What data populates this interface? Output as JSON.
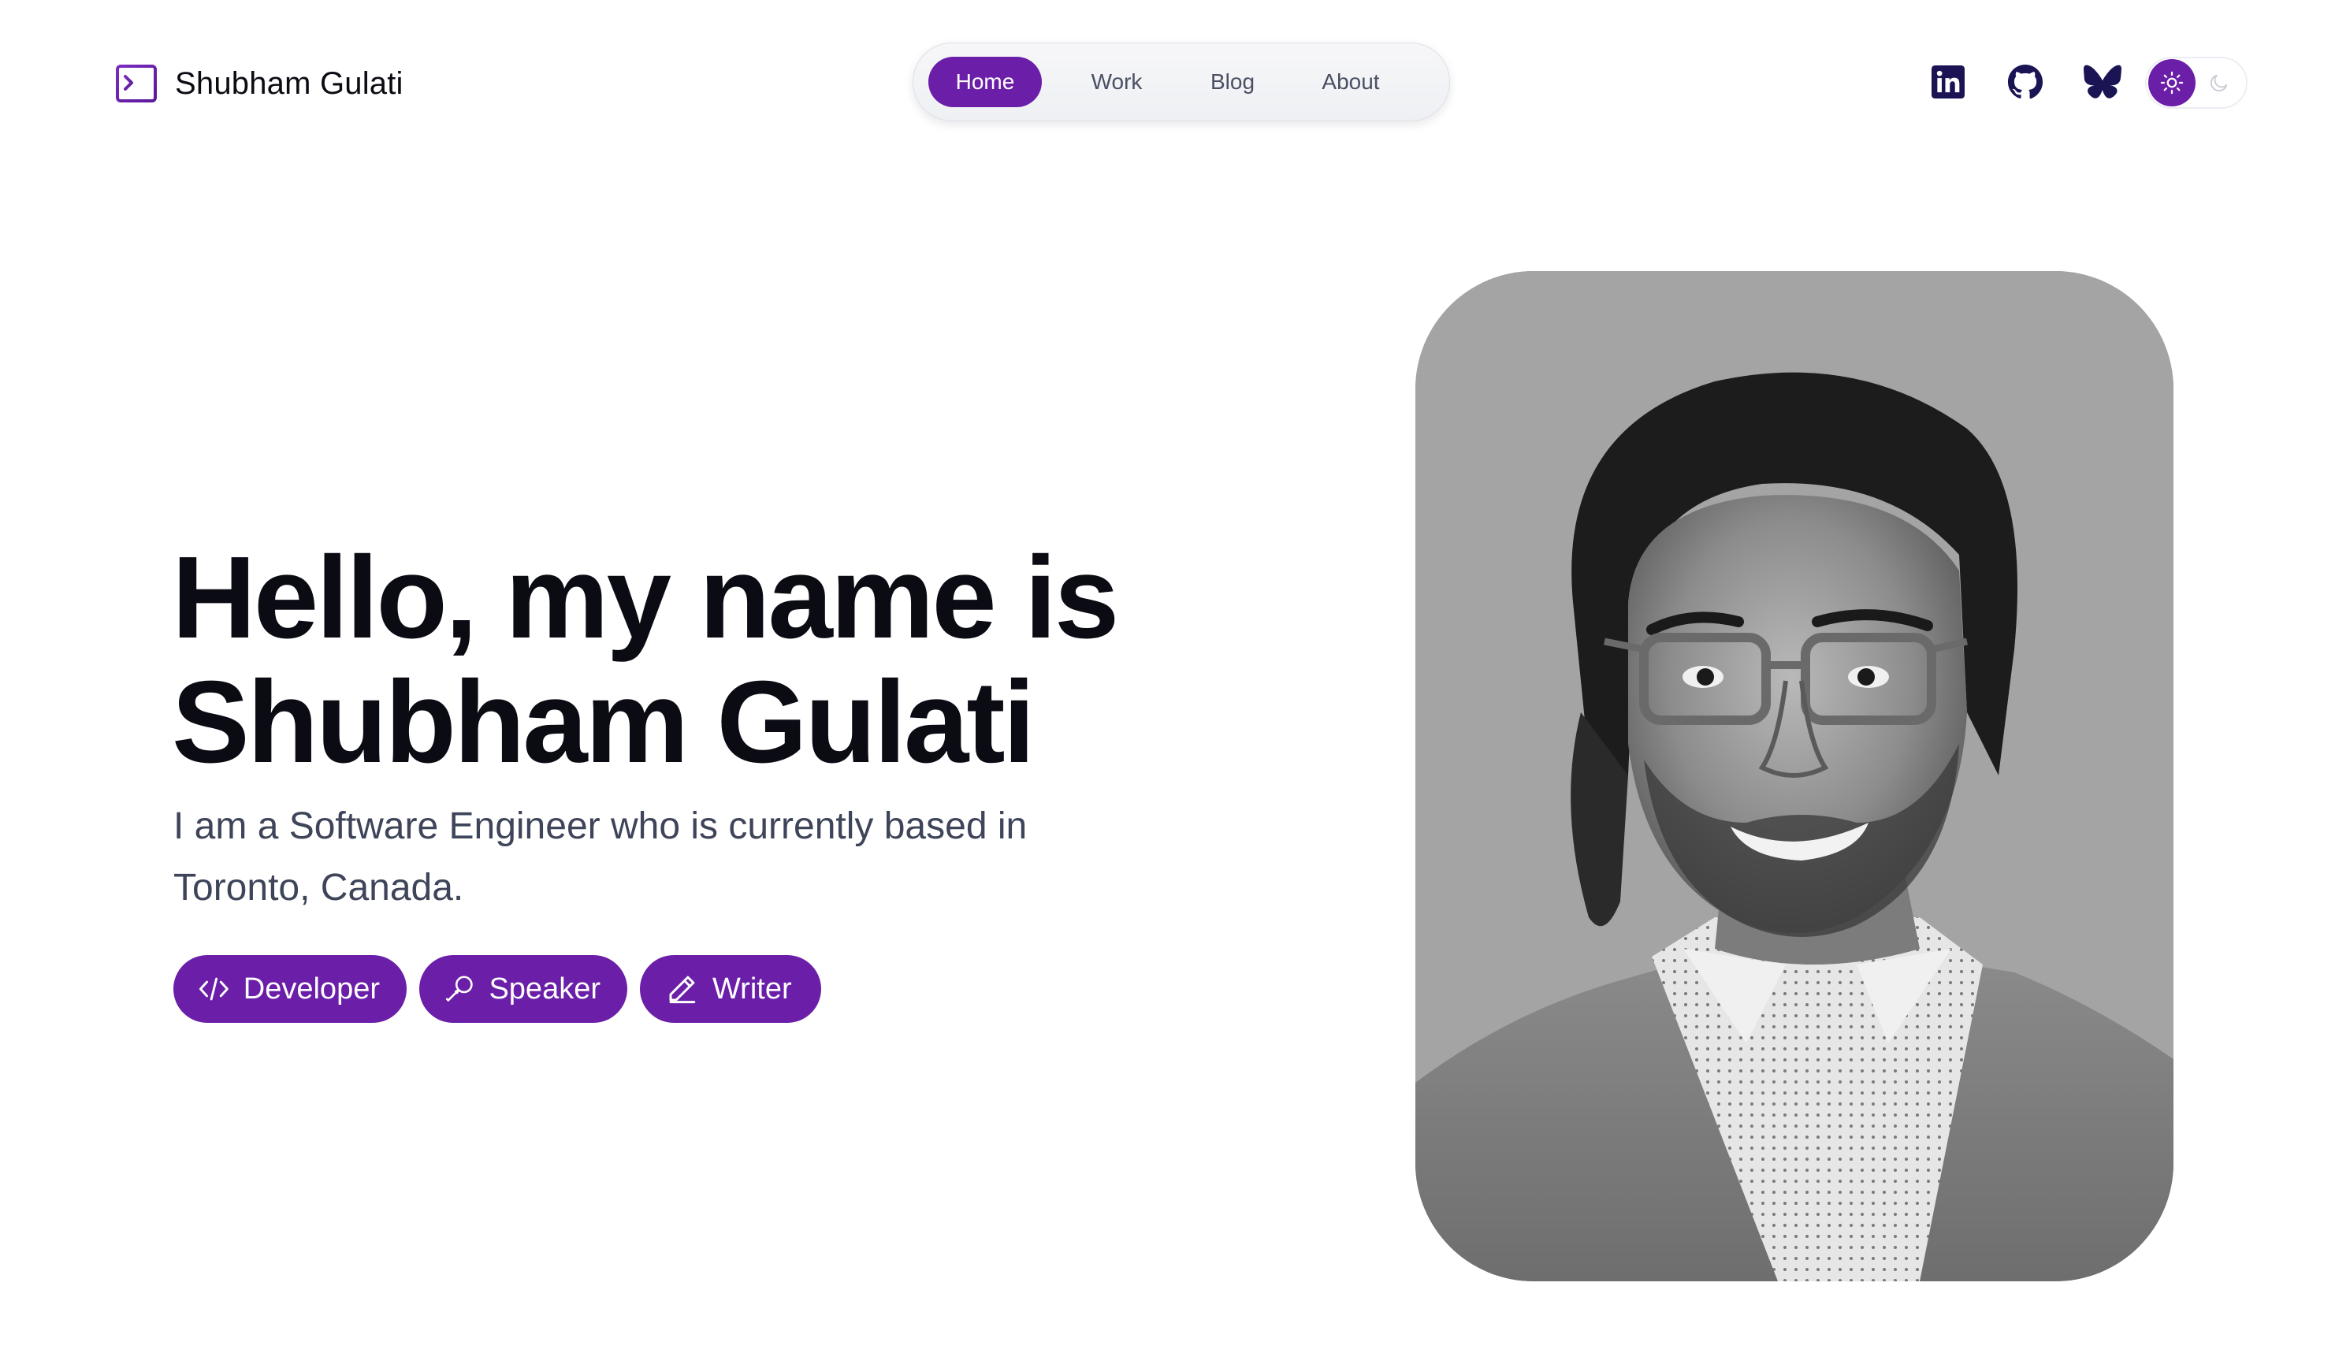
{
  "site": {
    "name": "Shubham Gulati",
    "logo_icon": "terminal-icon"
  },
  "nav": {
    "items": [
      {
        "label": "Home",
        "active": true
      },
      {
        "label": "Work",
        "active": false
      },
      {
        "label": "Blog",
        "active": false
      },
      {
        "label": "About",
        "active": false
      }
    ]
  },
  "socials": [
    {
      "name": "linkedin",
      "icon": "linkedin-icon"
    },
    {
      "name": "github",
      "icon": "github-icon"
    },
    {
      "name": "bluesky",
      "icon": "butterfly-icon"
    }
  ],
  "theme_toggle": {
    "options": [
      {
        "icon": "sun-icon",
        "selected": true
      },
      {
        "icon": "moon-icon",
        "selected": false
      }
    ]
  },
  "hero": {
    "title_line1": "Hello, my name is",
    "title_line2": "Shubham Gulati",
    "subtitle": "I am a Software Engineer who is currently based in Toronto, Canada."
  },
  "roles": [
    {
      "label": "Developer",
      "icon": "code-icon"
    },
    {
      "label": "Speaker",
      "icon": "microphone-icon"
    },
    {
      "label": "Writer",
      "icon": "pencil-icon"
    }
  ],
  "colors": {
    "accent": "#6b1fa8",
    "text": "#0b0b14",
    "muted": "#3e4459",
    "nav_text": "#4a4f63",
    "social_icon": "#1a1454",
    "portrait_bg": "#a4a4a4"
  }
}
